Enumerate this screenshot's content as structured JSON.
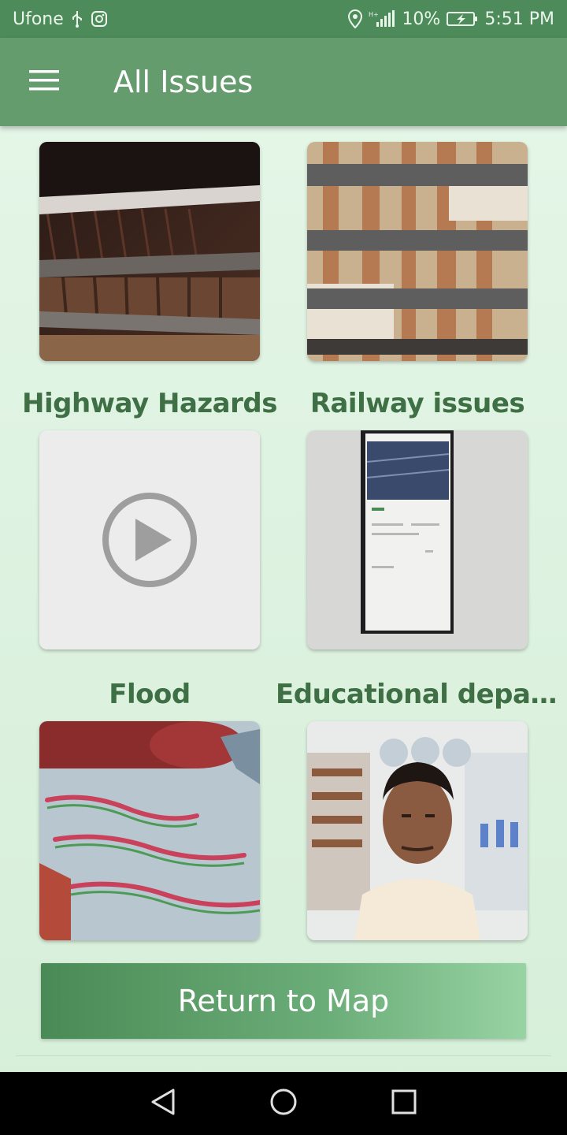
{
  "status_bar": {
    "carrier": "Ufone",
    "network": "H+",
    "battery": "10%",
    "time": "5:51 PM",
    "icons": [
      "usb-icon",
      "instagram-icon",
      "location-icon",
      "signal-icon",
      "battery-charging-icon"
    ]
  },
  "app_bar": {
    "title": "All Issues",
    "menu_icon": "hamburger-menu-icon"
  },
  "issues": [
    {
      "label": "",
      "thumbnail": "wooden-ceiling-dark-photo"
    },
    {
      "label": "",
      "thumbnail": "wooden-ceiling-light-photo"
    },
    {
      "label": "Highway Hazards",
      "thumbnail": "video-placeholder"
    },
    {
      "label": "Railway issues",
      "thumbnail": "phone-screenshot-photo"
    },
    {
      "label": "Flood",
      "thumbnail": "bedsheet-photo"
    },
    {
      "label": "Educational depar...",
      "thumbnail": "man-portrait-photo"
    }
  ],
  "actions": {
    "return_label": "Return to Map"
  },
  "colors": {
    "app_bar": "#649c6e",
    "status_bar": "#4e8b5a",
    "label_text": "#3f6f44",
    "button_gradient_start": "#4a8a56",
    "button_gradient_end": "#98d3a4"
  },
  "nav_bar": {
    "icons": [
      "back-triangle-icon",
      "home-circle-icon",
      "recents-square-icon"
    ]
  }
}
